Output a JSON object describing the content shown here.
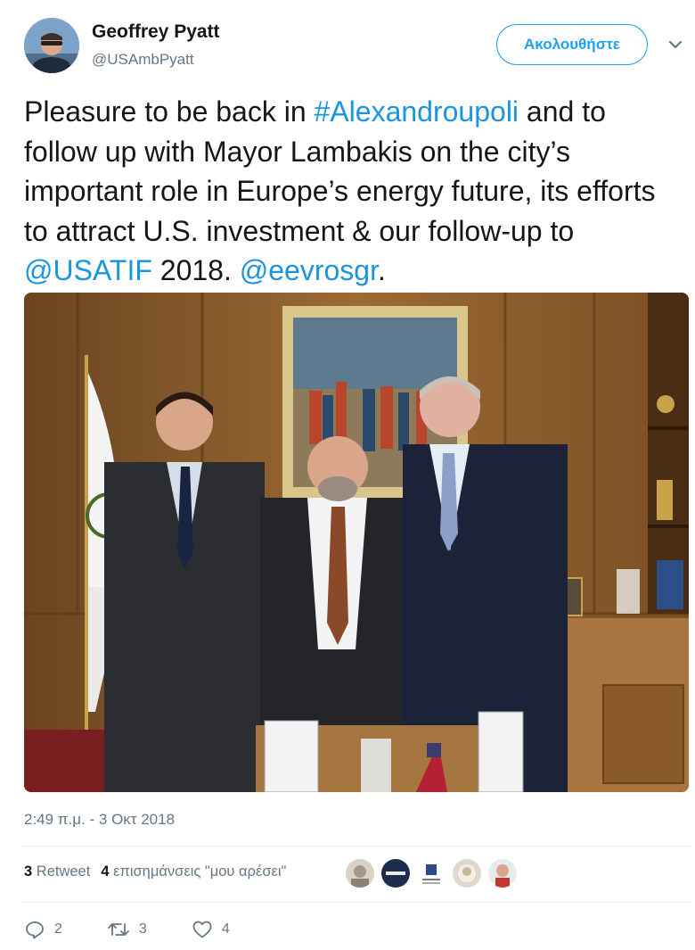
{
  "header": {
    "display_name": "Geoffrey Pyatt",
    "handle": "@USAmbPyatt",
    "follow_label": "Ακολουθήστε"
  },
  "tweet": {
    "text_parts": [
      "Pleasure to be back in ",
      "#Alexandroupoli",
      " and to follow up with Mayor Lambakis on the city’s important role in Europe’s energy future, its efforts to attract U.S. investment & our follow-up to ",
      "@USATIF",
      " 2018. ",
      "@eevrosgr",
      "."
    ],
    "timestamp": "2:49 π.μ. - 3 Οκτ 2018"
  },
  "stats": {
    "retweets_count": "3",
    "retweets_label": "Retweet",
    "likes_count": "4",
    "likes_label": "επισημάνσεις \"μου αρέσει\""
  },
  "actions": {
    "reply_count": "2",
    "retweet_count": "3",
    "like_count": "4"
  },
  "colors": {
    "accent": "#1da1f2",
    "link": "#1b95e0",
    "muted": "#657786"
  }
}
